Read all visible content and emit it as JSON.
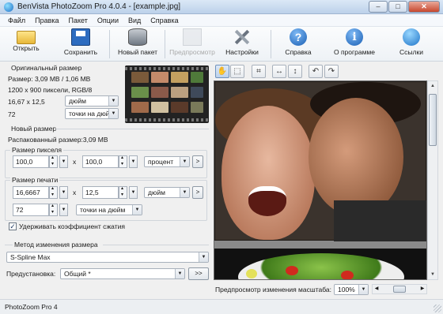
{
  "window": {
    "title": "BenVista PhotoZoom Pro 4.0.4 - [example.jpg]",
    "buttons": {
      "minimize": "–",
      "maximize": "□",
      "close": "✕"
    }
  },
  "menu": [
    "Файл",
    "Правка",
    "Пакет",
    "Опции",
    "Вид",
    "Справка"
  ],
  "toolbar": {
    "open": "Открыть",
    "save": "Сохранить",
    "new_batch": "Новый пакет",
    "preview": "Предпросмотр",
    "settings": "Настройки",
    "help": "Справка",
    "about": "О программе",
    "links": "Ссылки"
  },
  "original": {
    "header": "Оригинальный размер",
    "size": "Размер: 3,09 MB / 1,06 MB",
    "pixels": "1200 x 900 пиксели, RGB/8",
    "dims": "16,67 x 12,5",
    "dims_unit": "дюйм",
    "res": "72",
    "res_unit": "точки на дюйм"
  },
  "new_size": {
    "header": "Новый размер",
    "unpacked": "Распакованный размер:3,09 MB",
    "pixel_group": "Размер пикселя",
    "pixel_w": "100,0",
    "pixel_h": "100,0",
    "pixel_unit": "процент",
    "print_group": "Размер печати",
    "print_w": "16,6667",
    "print_h": "12,5",
    "print_unit": "дюйм",
    "print_res": "72",
    "print_res_unit": "точки на дюйм",
    "times": "x",
    "more": ">",
    "keep_ratio": "Удерживать коэффициент сжатия",
    "keep_ratio_checked": true
  },
  "method": {
    "header": "Метод изменения размера",
    "value": "S-Spline Max",
    "preset_label": "Предустановка:",
    "preset_value": "Общий *",
    "more": ">>"
  },
  "image_toolbar": {
    "hand": "✋",
    "select": "⬚",
    "crop": "⌗",
    "width": "↔",
    "height": "↕",
    "rotate_left": "↶",
    "rotate_right": "↷"
  },
  "preview_zoom": {
    "label": "Предпросмотр изменения масштаба:",
    "value": "100%"
  },
  "statusbar": {
    "text": "PhotoZoom Pro 4"
  },
  "colors": {
    "titlebar": "#bcd1ea",
    "accent": "#1a5fb4",
    "window_bg": "#f0f0f0"
  },
  "icons": {
    "open": "folder-icon",
    "save": "floppy-icon",
    "new_batch": "database-icon",
    "preview": "preview-icon",
    "settings": "tools-icon",
    "help": "question-icon",
    "about": "info-icon",
    "links": "globe-icon"
  }
}
